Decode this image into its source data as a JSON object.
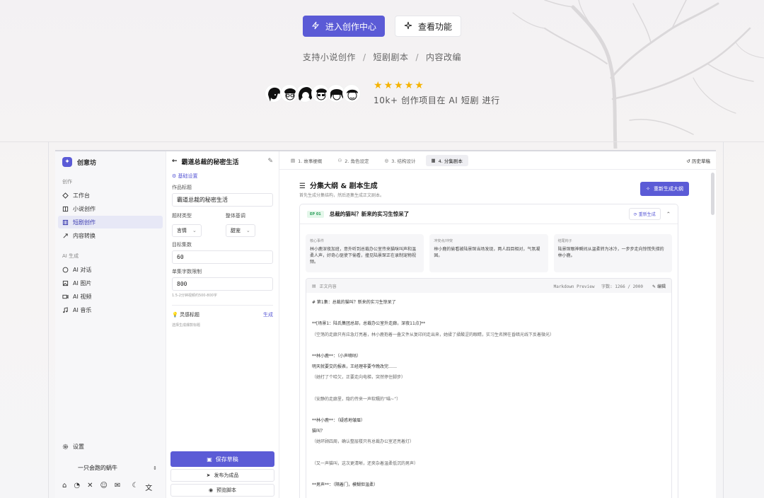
{
  "hero": {
    "primary_button": "进入创作中心",
    "secondary_button": "查看功能",
    "tagline": [
      "支持小说创作",
      "短剧剧本",
      "内容改编"
    ],
    "tagline_sep": "/",
    "rating_stars": 5,
    "proof_text": "10k+ 创作项目在 AI 短剧 进行"
  },
  "sidebar": {
    "brand": "创意坊",
    "section_create": "创作",
    "create_items": [
      {
        "label": "工作台",
        "icon": "workbench-icon"
      },
      {
        "label": "小说创作",
        "icon": "book-icon"
      },
      {
        "label": "短剧创作",
        "icon": "film-icon",
        "active": true
      },
      {
        "label": "内容转换",
        "icon": "transform-icon"
      }
    ],
    "section_ai": "AI 生成",
    "ai_items": [
      {
        "label": "AI 对话",
        "icon": "chat-icon"
      },
      {
        "label": "AI 图片",
        "icon": "image-icon"
      },
      {
        "label": "AI 视频",
        "icon": "video-icon"
      },
      {
        "label": "AI 音乐",
        "icon": "music-icon"
      }
    ],
    "settings": "设置",
    "user_name": "一只会跑的蜗牛"
  },
  "form": {
    "title": "霸道总裁的秘密生活",
    "section_basic": "基础设置",
    "work_title_label": "作品标题",
    "work_title_value": "霸道总裁的秘密生活",
    "genre_label": "题材类型",
    "genre_value": "言情",
    "tone_label": "整体基调",
    "tone_value": "甜宠",
    "episodes_label": "目标集数",
    "episodes_value": "60",
    "words_label": "单集字数限制",
    "words_value": "800",
    "words_note": "1.5-2分钟视频约500-800字",
    "inspiration_label": "灵感标题",
    "inspiration_action": "生成",
    "inspiration_note": "选择生成爆款标题",
    "save_button": "保存草稿",
    "publish_button": "发布为成品",
    "preview_button": "预览脚本"
  },
  "main": {
    "tabs": [
      "1. 故事梗概",
      "2. 角色设定",
      "3. 结构设计",
      "4. 分集剧本"
    ],
    "history": "历史草稿",
    "title": "分集大纲 & 剧本生成",
    "subtitle": "首先生成分集结构，然后逐集生成正文剧本。",
    "regen_all": "重新生成大纲",
    "episode": {
      "badge": "EP 01",
      "title": "总裁的猫叫？新来的实习生惊呆了",
      "regen": "重新生成",
      "facts": [
        {
          "label": "核心事件",
          "text": "林小鹿深夜加班，意外听到总裁办公室传来猫咪叫声和温柔人声，好奇心驱使下偷看，撞见陆景琛正在录制宠物视频。"
        },
        {
          "label": "冲突点/冲突",
          "text": "林小鹿的偷看被陆景琛当场发现，两人四目相对，气氛凝固。"
        },
        {
          "label": "结尾钩子",
          "text": "陆景琛眼神瞬间从温柔转为冰冷，一步步走向惊慌失措的林小鹿。"
        }
      ],
      "editor_label": "正文内容",
      "editor_mode": "Markdown Preview",
      "word_count": "字数: 1266 / 2000",
      "edit": "编辑",
      "lines": [
        "# 第1集：总裁的猫叫？新来的实习生惊呆了",
        "",
        "**[场景1：陆氏集团总部，总裁办公室外走廊，深夜11点]**",
        "（空荡的走廊只有应急灯亮着，林小鹿抱着一叠文件从复印间走出来，她揉了揉酸涩的眼睛，实习生名牌在昏暗光线下反着微光）",
        "",
        "**林小鹿**：（小声嘀咕）",
        "明天就要交的报表，王经理非要今晚改完……",
        "（她打了个哈欠，正要走向电梯，突然停住脚步）",
        "",
        "（安静的走廊里，隐约传来一声软糯的“喵~”）",
        "",
        "**林小鹿**：（疑惑地皱眉）",
        "猫叫？",
        "（她环顾四周，确认整层楼只有总裁办公室还亮着灯）",
        "",
        "（又一声猫叫，这次更清晰，还夹杂着温柔低沉的男声）",
        "",
        "**男声**：（隔着门，模糊但温柔）"
      ]
    }
  }
}
